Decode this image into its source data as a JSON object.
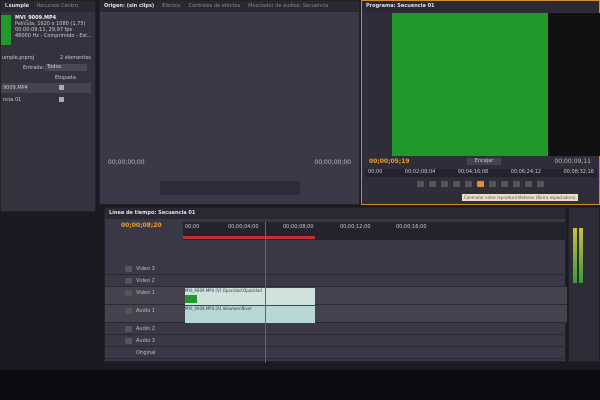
{
  "project": {
    "tabs": [
      "l.sumple",
      "Recursos Centro"
    ],
    "clip_name": "MVI_9009.MP4",
    "clip_info": [
      "Película, 1920 x 1080 (1,75)",
      "00:00:09:11, 29,97 fps",
      "48000 Hz - Comprimido - Est..."
    ],
    "project_file": "umple.prproj",
    "count": "2 elementos",
    "entry_label": "Entrada:",
    "entry_value": "Todos",
    "column_label": "Etiqueta",
    "items": [
      "9009.MP4",
      "ncia 01"
    ]
  },
  "source": {
    "tabs": [
      "Origen: (sin clips)",
      "Efectos",
      "Controles de efectos",
      "Mezclador de audios: Secuencia"
    ],
    "tc_left": "00;00;00;00",
    "tc_right": "00;00;00;00"
  },
  "program": {
    "tab": "Programa: Secuencia 01",
    "tc_current": "00;00;05;19",
    "zoom": "Encajar",
    "tc_duration": "00;00;09;11",
    "ruler": [
      "00;00",
      "00;02;08;04",
      "00;04;16;08",
      "00;06;24;12",
      "00;08;32;16"
    ],
    "tooltip": "Conmutar entre reproducir/detener (Barra espaciadora)",
    "frame_color": "#1f9a2a"
  },
  "timeline": {
    "tab": "Línea de tiempo: Secuencia 01",
    "tc": "00;00;08;20",
    "ruler": [
      "00;00",
      "00;00;04;00",
      "00;00;08;00",
      "00;00;12;00",
      "00;00;16;00"
    ],
    "tracks": [
      "Video 3",
      "Video 2",
      "Video 1",
      "Audio 1",
      "Audio 2",
      "Audio 3",
      "Original"
    ],
    "video_clip": "MVI_9009.MP4 [V] Opacidad:Opacidad",
    "audio_clip": "MVI_9009.MP4 [A] Volumen:Nivel"
  }
}
